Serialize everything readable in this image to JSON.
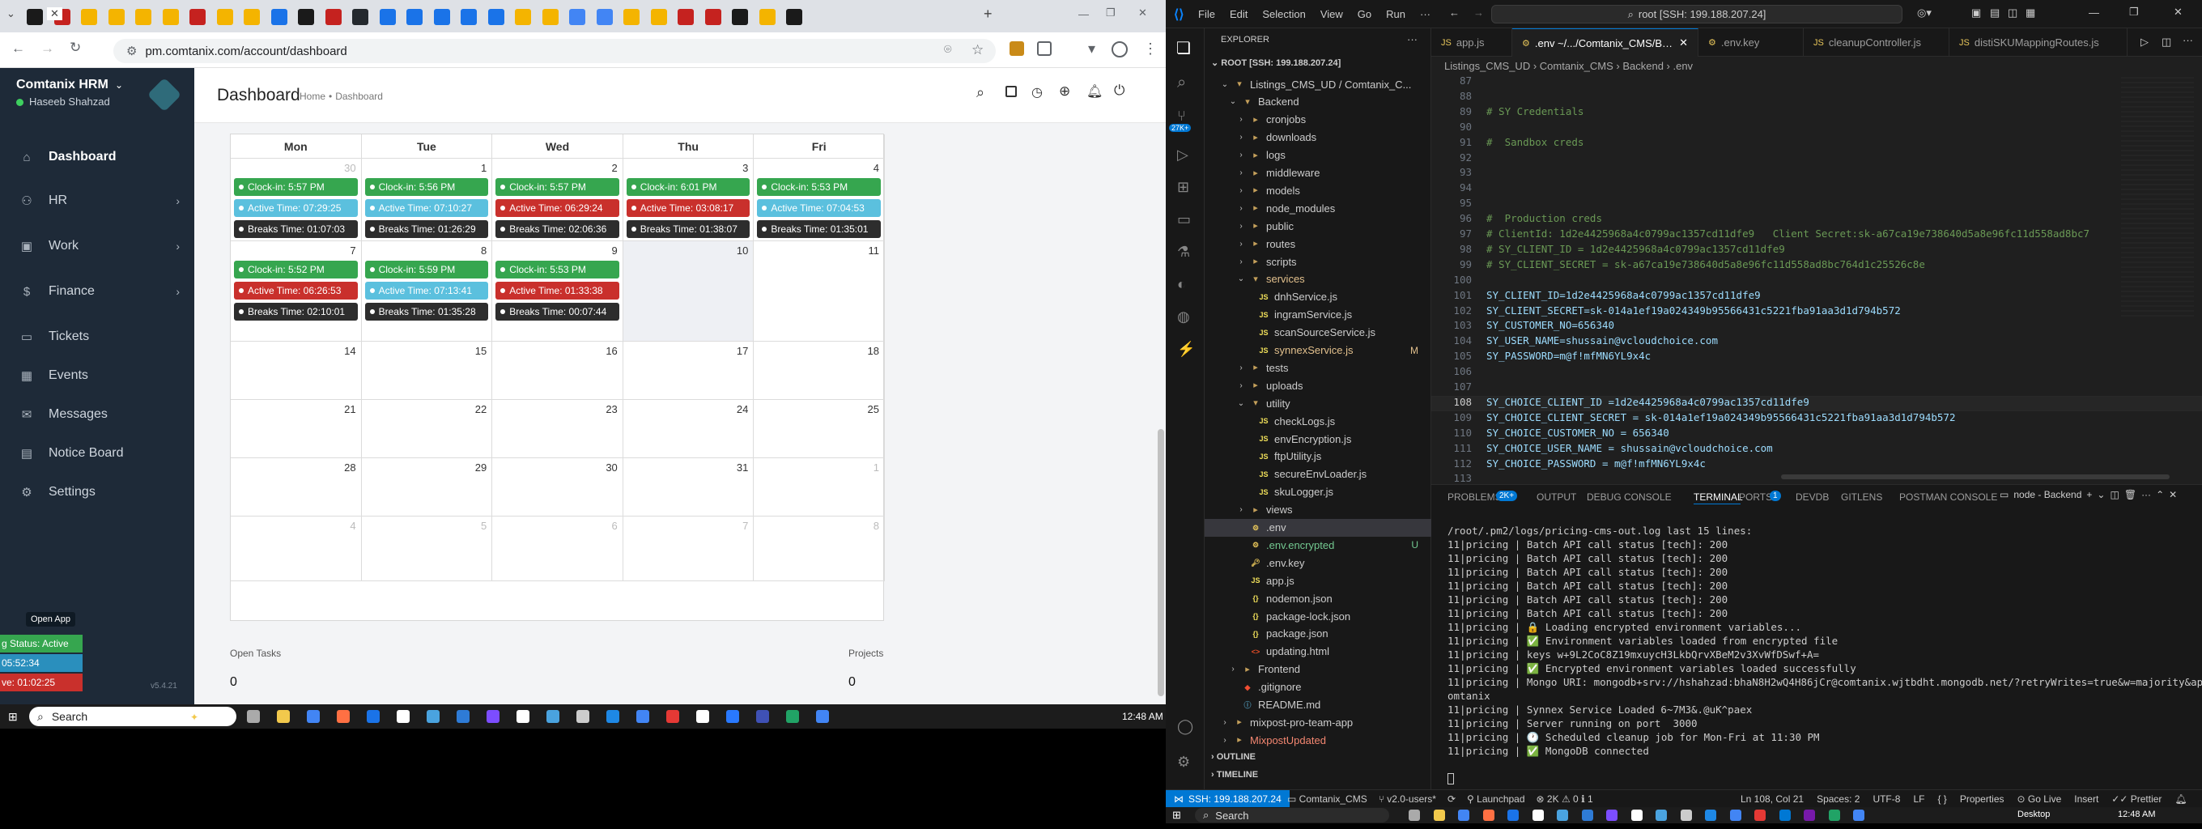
{
  "browser": {
    "url": "pm.comtanix.com/account/dashboard",
    "tabs": [
      "",
      "",
      "",
      "",
      "",
      "",
      "",
      "",
      "",
      "",
      "",
      "",
      "",
      "",
      "",
      "",
      "",
      "",
      "",
      "",
      "",
      "",
      "",
      "",
      "",
      "",
      "",
      "",
      "",
      ""
    ],
    "new_tab": "+"
  },
  "app": {
    "brand": "Comtanix HRM",
    "user": "Haseeb Shahzad",
    "version": "v5.4.21",
    "page_title": "Dashboard",
    "breadcrumb_home": "Home",
    "breadcrumb_sep": "•",
    "breadcrumb_current": "Dashboard",
    "nav": [
      {
        "label": "Dashboard",
        "icon": "home-icon"
      },
      {
        "label": "HR",
        "icon": "users-icon"
      },
      {
        "label": "Work",
        "icon": "briefcase-icon"
      },
      {
        "label": "Finance",
        "icon": "dollar-icon"
      },
      {
        "label": "Tickets",
        "icon": "ticket-icon"
      },
      {
        "label": "Events",
        "icon": "calendar-icon"
      },
      {
        "label": "Messages",
        "icon": "message-icon"
      },
      {
        "label": "Notice Board",
        "icon": "notice-icon"
      },
      {
        "label": "Settings",
        "icon": "gear-icon"
      }
    ],
    "open_app": "Open App",
    "widget_status": "g Status: Active",
    "widget_time1": "05:52:34",
    "widget_time2": "ve: 01:02:25",
    "weekdays": [
      "Mon",
      "Tue",
      "Wed",
      "Thu",
      "Fri"
    ],
    "weeks": [
      {
        "days": [
          "30",
          "1",
          "2",
          "3",
          "4"
        ],
        "dim": [
          true,
          false,
          false,
          false,
          false
        ]
      },
      {
        "days": [
          "7",
          "8",
          "9",
          "10",
          "11"
        ],
        "dim": [
          false,
          false,
          false,
          false,
          false
        ]
      },
      {
        "days": [
          "14",
          "15",
          "16",
          "17",
          "18"
        ],
        "dim": [
          false,
          false,
          false,
          false,
          false
        ]
      },
      {
        "days": [
          "21",
          "22",
          "23",
          "24",
          "25"
        ],
        "dim": [
          false,
          false,
          false,
          false,
          false
        ]
      },
      {
        "days": [
          "28",
          "29",
          "30",
          "31",
          "1"
        ],
        "dim": [
          false,
          false,
          false,
          false,
          true
        ]
      },
      {
        "days": [
          "4",
          "5",
          "6",
          "7",
          "8"
        ],
        "dim": [
          true,
          true,
          true,
          true,
          true
        ]
      }
    ],
    "events": {
      "w0": [
        [
          "Clock-in: 5:57 PM",
          "Active Time: 07:29:25",
          "Breaks Time: 01:07:03"
        ],
        [
          "Clock-in: 5:56 PM",
          "Active Time: 07:10:27",
          "Breaks Time: 01:26:29"
        ],
        [
          "Clock-in: 5:57 PM",
          "Active Time: 06:29:24",
          "Breaks Time: 02:06:36"
        ],
        [
          "Clock-in: 6:01 PM",
          "Active Time: 03:08:17",
          "Breaks Time: 01:38:07"
        ],
        [
          "Clock-in: 5:53 PM",
          "Active Time: 07:04:53",
          "Breaks Time: 01:35:01"
        ]
      ],
      "w0_active_status": [
        "t",
        "t",
        "r",
        "r",
        "t"
      ],
      "w1": [
        [
          "Clock-in: 5:52 PM",
          "Active Time: 06:26:53",
          "Breaks Time: 02:10:01"
        ],
        [
          "Clock-in: 5:59 PM",
          "Active Time: 07:13:41",
          "Breaks Time: 01:35:28"
        ],
        [
          "Clock-in: 5:53 PM",
          "Active Time: 01:33:38",
          "Breaks Time: 00:07:44"
        ]
      ],
      "w1_active_status": [
        "r",
        "t",
        "r"
      ]
    },
    "open_tasks_label": "Open Tasks",
    "open_tasks_value": "0",
    "projects_label": "Projects",
    "projects_value": "0"
  },
  "taskbar_left": {
    "search": "Search",
    "time": "12:48 AM"
  },
  "vscode": {
    "menu": [
      "File",
      "Edit",
      "Selection",
      "View",
      "Go",
      "Run",
      "···"
    ],
    "search_box": "root [SSH: 199.188.207.24]",
    "explorer_title": "EXPLORER",
    "root": "ROOT [SSH: 199.188.207.24]",
    "tree": [
      {
        "t": "Listings_CMS_UD / Comtanix_C...",
        "d": 1,
        "type": "folder-open"
      },
      {
        "t": "Backend",
        "d": 2,
        "type": "folder-open"
      },
      {
        "t": "cronjobs",
        "d": 3,
        "type": "folder"
      },
      {
        "t": "downloads",
        "d": 3,
        "type": "folder"
      },
      {
        "t": "logs",
        "d": 3,
        "type": "folder"
      },
      {
        "t": "middleware",
        "d": 3,
        "type": "folder"
      },
      {
        "t": "models",
        "d": 3,
        "type": "folder"
      },
      {
        "t": "node_modules",
        "d": 3,
        "type": "folder"
      },
      {
        "t": "public",
        "d": 3,
        "type": "folder"
      },
      {
        "t": "routes",
        "d": 3,
        "type": "folder"
      },
      {
        "t": "scripts",
        "d": 3,
        "type": "folder"
      },
      {
        "t": "services",
        "d": 3,
        "type": "folder-open",
        "color": "#e2c08d"
      },
      {
        "t": "dnhService.js",
        "d": 4,
        "type": "js"
      },
      {
        "t": "ingramService.js",
        "d": 4,
        "type": "js"
      },
      {
        "t": "scanSourceService.js",
        "d": 4,
        "type": "js"
      },
      {
        "t": "synnexService.js",
        "d": 4,
        "type": "js",
        "color": "#e2c08d",
        "badge": "M"
      },
      {
        "t": "tests",
        "d": 3,
        "type": "folder"
      },
      {
        "t": "uploads",
        "d": 3,
        "type": "folder"
      },
      {
        "t": "utility",
        "d": 3,
        "type": "folder-open"
      },
      {
        "t": "checkLogs.js",
        "d": 4,
        "type": "js"
      },
      {
        "t": "envEncryption.js",
        "d": 4,
        "type": "js"
      },
      {
        "t": "ftpUtility.js",
        "d": 4,
        "type": "js"
      },
      {
        "t": "secureEnvLoader.js",
        "d": 4,
        "type": "js"
      },
      {
        "t": "skuLogger.js",
        "d": 4,
        "type": "js"
      },
      {
        "t": "views",
        "d": 3,
        "type": "folder"
      },
      {
        "t": ".env",
        "d": 3,
        "type": "env",
        "selected": true
      },
      {
        "t": ".env.encrypted",
        "d": 3,
        "type": "env",
        "color": "#73c991",
        "badge": "U"
      },
      {
        "t": ".env.key",
        "d": 3,
        "type": "key"
      },
      {
        "t": "app.js",
        "d": 3,
        "type": "js"
      },
      {
        "t": "nodemon.json",
        "d": 3,
        "type": "json"
      },
      {
        "t": "package-lock.json",
        "d": 3,
        "type": "json"
      },
      {
        "t": "package.json",
        "d": 3,
        "type": "json"
      },
      {
        "t": "updating.html",
        "d": 3,
        "type": "html"
      },
      {
        "t": "Frontend",
        "d": 2,
        "type": "folder"
      },
      {
        "t": ".gitignore",
        "d": 2,
        "type": "git"
      },
      {
        "t": "README.md",
        "d": 2,
        "type": "md"
      },
      {
        "t": "mixpost-pro-team-app",
        "d": 1,
        "type": "folder"
      },
      {
        "t": "MixpostUpdated",
        "d": 1,
        "type": "folder",
        "color": "#f48771"
      }
    ],
    "outline": "OUTLINE",
    "timeline": "TIMELINE",
    "editor_tabs": [
      {
        "label": "app.js",
        "active": false
      },
      {
        "label": ".env ~/.../Comtanix_CMS/Backend",
        "active": true
      },
      {
        "label": ".env.key",
        "active": false
      },
      {
        "label": "cleanupController.js",
        "active": false
      },
      {
        "label": "distiSKUMappingRoutes.js",
        "active": false
      }
    ],
    "breadcrumb": "Listings_CMS_UD  ›  Comtanix_CMS  ›  Backend  ›  .env",
    "lines": [
      {
        "n": "87",
        "c": "",
        "cm": false
      },
      {
        "n": "88",
        "c": "",
        "cm": false
      },
      {
        "n": "89",
        "c": "# SY Credentials",
        "cm": true
      },
      {
        "n": "90",
        "c": "",
        "cm": false
      },
      {
        "n": "91",
        "c": "#  Sandbox creds",
        "cm": true
      },
      {
        "n": "92",
        "c": "",
        "cm": false
      },
      {
        "n": "93",
        "c": "",
        "cm": false
      },
      {
        "n": "94",
        "c": "",
        "cm": false
      },
      {
        "n": "95",
        "c": "",
        "cm": false
      },
      {
        "n": "96",
        "c": "#  Production creds",
        "cm": true
      },
      {
        "n": "97",
        "c": "# ClientId: 1d2e4425968a4c0799ac1357cd11dfe9   Client Secret:sk-a67ca19e738640d5a8e96fc11d558ad8bc7",
        "cm": true
      },
      {
        "n": "98",
        "c": "# SY_CLIENT_ID = 1d2e4425968a4c0799ac1357cd11dfe9",
        "cm": true
      },
      {
        "n": "99",
        "c": "# SY_CLIENT_SECRET = sk-a67ca19e738640d5a8e96fc11d558ad8bc764d1c25526c8e",
        "cm": true
      },
      {
        "n": "100",
        "c": "",
        "cm": false
      },
      {
        "n": "101",
        "c": "SY_CLIENT_ID=1d2e4425968a4c0799ac1357cd11dfe9",
        "cm": false
      },
      {
        "n": "102",
        "c": "SY_CLIENT_SECRET=sk-014a1ef19a024349b95566431c5221fba91aa3d1d794b572",
        "cm": false
      },
      {
        "n": "103",
        "c": "SY_CUSTOMER_NO=656340",
        "cm": false
      },
      {
        "n": "104",
        "c": "SY_USER_NAME=shussain@vcloudchoice.com",
        "cm": false
      },
      {
        "n": "105",
        "c": "SY_PASSWORD=m@f!mfMN6YL9x4c",
        "cm": false
      },
      {
        "n": "106",
        "c": "",
        "cm": false
      },
      {
        "n": "107",
        "c": "",
        "cm": false
      },
      {
        "n": "108",
        "c": "SY_CHOICE_CLIENT_ID =1d2e4425968a4c0799ac1357cd11dfe9",
        "cm": false
      },
      {
        "n": "109",
        "c": "SY_CHOICE_CLIENT_SECRET = sk-014a1ef19a024349b95566431c5221fba91aa3d1d794b572",
        "cm": false
      },
      {
        "n": "110",
        "c": "SY_CHOICE_CUSTOMER_NO = 656340",
        "cm": false
      },
      {
        "n": "111",
        "c": "SY_CHOICE_USER_NAME = shussain@vcloudchoice.com",
        "cm": false
      },
      {
        "n": "112",
        "c": "SY_CHOICE_PASSWORD = m@f!mfMN6YL9x4c",
        "cm": false
      },
      {
        "n": "113",
        "c": "",
        "cm": false
      }
    ],
    "panel_tabs": [
      "PROBLEMS",
      "OUTPUT",
      "DEBUG CONSOLE",
      "TERMINAL",
      "PORTS",
      "DEVDB",
      "GITLENS",
      "POSTMAN CONSOLE"
    ],
    "problems_count": "2K+",
    "ports_count": "1",
    "terminal_name": "node - Backend",
    "terminal": [
      "/root/.pm2/logs/pricing-cms-out.log last 15 lines:",
      "11|pricing | Batch API call status [tech]: 200",
      "11|pricing | Batch API call status [tech]: 200",
      "11|pricing | Batch API call status [tech]: 200",
      "11|pricing | Batch API call status [tech]: 200",
      "11|pricing | Batch API call status [tech]: 200",
      "11|pricing | Batch API call status [tech]: 200",
      "11|pricing | 🔒 Loading encrypted environment variables...",
      "11|pricing | ✅ Environment variables loaded from encrypted file",
      "11|pricing | keys w+9L2CoC8Z19mxuycH3LkbQrvXBeM2v3XvWfDSwf+A=",
      "11|pricing | ✅ Encrypted environment variables loaded successfully",
      "11|pricing | Mongo URI: mongodb+srv://hshahzad:bhaN8H2wQ4H86jCr@comtanix.wjtbdht.mongodb.net/?retryWrites=true&w=majority&appName=C",
      "omtanix",
      "11|pricing | Synnex Service Loaded 6~7M3&.@uK^paex",
      "11|pricing | Server running on port  3000",
      "11|pricing | 🕐 Scheduled cleanup job for Mon-Fri at 11:30 PM",
      "11|pricing | ✅ MongoDB connected"
    ],
    "status": {
      "ssh": "SSH: 199.188.207.24",
      "folder": "Comtanix_CMS",
      "branch": "v2.0-users*",
      "launchpad": "Launchpad",
      "errors": "2K",
      "warnings": "0",
      "info": "1",
      "position": "Ln 108, Col 21",
      "spaces": "Spaces: 2",
      "encoding": "UTF-8",
      "eol": "LF",
      "props": "Properties",
      "golive": "Go Live",
      "insert": "Insert",
      "prettier": "Prettier"
    }
  },
  "taskbar_right": {
    "search": "Search",
    "desktop": "Desktop",
    "time": "12:48 AM"
  },
  "colors": {
    "green": "#36a64f",
    "teal": "#5bc0de",
    "red": "#c9302c",
    "dark": "#2d2d2d",
    "sidebar": "#1e2a38",
    "vsblue": "#0078d4"
  }
}
